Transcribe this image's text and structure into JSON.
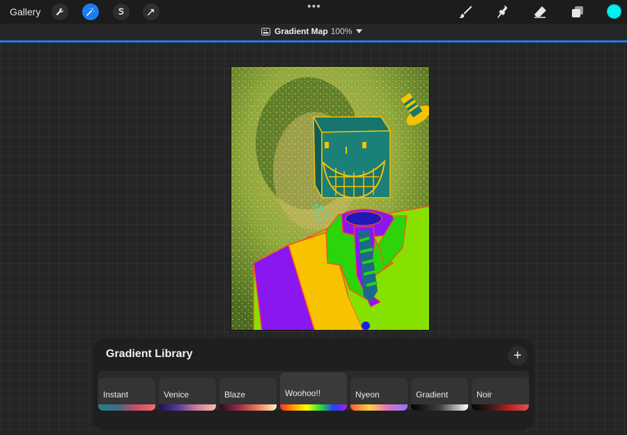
{
  "toolbar": {
    "gallery_label": "Gallery",
    "left_tools": [
      {
        "name": "wrench-icon",
        "active": false
      },
      {
        "name": "magic-wand-icon",
        "active": true
      },
      {
        "name": "selection-icon",
        "active": false
      },
      {
        "name": "transform-arrow-icon",
        "active": false
      }
    ],
    "more_label": "•••",
    "right_tools": [
      "brush-icon",
      "smudge-icon",
      "eraser-icon",
      "layers-icon"
    ],
    "current_color": "#00f0f0"
  },
  "adjustment": {
    "title": "Gradient Map",
    "opacity": "100%",
    "accent": "#1f7cf0"
  },
  "gradient_library": {
    "title": "Gradient Library",
    "add_label": "+",
    "items": [
      {
        "label": "Instant",
        "colors": [
          "#2a7f86",
          "#3b6d86",
          "#d04a66",
          "#f07070"
        ],
        "selected": false
      },
      {
        "label": "Venice",
        "colors": [
          "#1a1050",
          "#5a3a9a",
          "#d07aa0",
          "#f5c0a8"
        ],
        "selected": false
      },
      {
        "label": "Blaze",
        "colors": [
          "#2a0a20",
          "#9a2a4a",
          "#f07a5a",
          "#fff0c0"
        ],
        "selected": false
      },
      {
        "label": "Woohoo!!",
        "colors": [
          "#ff2a2a",
          "#ffa000",
          "#ffff00",
          "#30e030",
          "#2040ff",
          "#a020f0"
        ],
        "selected": true
      },
      {
        "label": "Nyeon",
        "colors": [
          "#ff5a3a",
          "#ffd040",
          "#e070c0",
          "#8a7aff"
        ],
        "selected": false
      },
      {
        "label": "Gradient",
        "colors": [
          "#000000",
          "#404040",
          "#ffffff"
        ],
        "selected": false
      },
      {
        "label": "Noir",
        "colors": [
          "#050505",
          "#3a1a1a",
          "#c02020",
          "#e05050"
        ],
        "selected": false
      }
    ]
  }
}
